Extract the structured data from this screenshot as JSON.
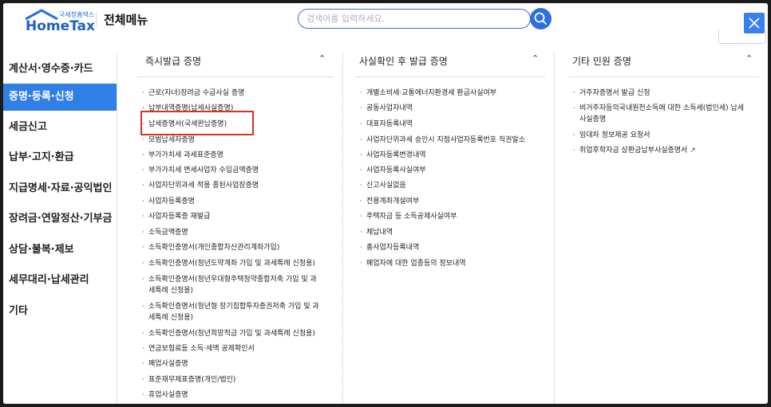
{
  "header": {
    "logo_small": "국세청홈택스",
    "logo_main": "HomeTax",
    "menu_title": "전체메뉴",
    "search_placeholder": "검색어를 입력하세요.",
    "search_icon": "search-icon",
    "close_icon": "close-icon"
  },
  "sidebar": {
    "items": [
      {
        "label": "계산서·영수증·카드",
        "active": false
      },
      {
        "label": "증명·등록·신청",
        "active": true
      },
      {
        "label": "세금신고",
        "active": false
      },
      {
        "label": "납부·고지·환급",
        "active": false
      },
      {
        "label": "지급명세·자료·공익법인",
        "active": false
      },
      {
        "label": "장려금·연말정산·기부금",
        "active": false
      },
      {
        "label": "상담·불복·제보",
        "active": false
      },
      {
        "label": "세무대리·납세관리",
        "active": false
      },
      {
        "label": "기타",
        "active": false
      }
    ],
    "active_color": "#2f7fe6"
  },
  "columns": [
    {
      "title": "즉시발급 증명",
      "chevron": "chevron-up-icon",
      "items": [
        "근로(자녀)장려금 수급사실 증명",
        "납부내역증명(납세사실증명)",
        "납세증명서(국세완납증명)",
        "모범납세자증명",
        "부가가치세 과세표준증명",
        "부가가치세 면세사업자 수입금액증명",
        "사업자단위과세 적용 종된사업장증명",
        "사업자등록증명",
        "사업자등록증 재발급",
        "소득금액증명",
        "소득확인증명서(개인종합자산관리계좌가입)",
        "소득확인증명서(청년도약계좌 가입 및 과세특례 신청용)",
        "소득확인증명서(청년우대형주택청약종합저축 가입 및 과세특례 신청용)",
        "소득확인증명서(청년형 장기집합투자증권저축 가입 및 과세특례 신청용)",
        "소득확인증명서(청년희망적금 가입 및 과세특례 신청용)",
        "연금보험료등 소득·세액 공제확인서",
        "폐업사실증명",
        "표준재무제표증명(개인/법인)",
        "휴업사실증명"
      ]
    },
    {
      "title": "사실확인 후 발급 증명",
      "chevron": "chevron-up-icon",
      "items": [
        "개별소비세·교통에너지환경세 환급사실여부",
        "공동사업자내역",
        "대표자등록내역",
        "사업자단위과세 승인시 지점사업자등록번호 직권말소",
        "사업자등록변경내역",
        "사업자등록사실여부",
        "신고사실없음",
        "전용계좌개설여부",
        "주택자금 등 소득공제사실여부",
        "체납내역",
        "총사업자등록내역",
        "폐업자에 대한 업종등의 정보내역"
      ]
    },
    {
      "title": "기타 민원 증명",
      "chevron": "chevron-up-icon",
      "items": [
        "거주자증명서 발급 신청",
        "비거주자등의국내원천소득에 대한 소득세(법인세) 납세사실증명",
        "임대차 정보제공 요청서",
        "취업후학자금 상환금납부사실증명서"
      ],
      "external_link_icon": "external-link-icon"
    }
  ],
  "highlight_color": "#e0301e"
}
